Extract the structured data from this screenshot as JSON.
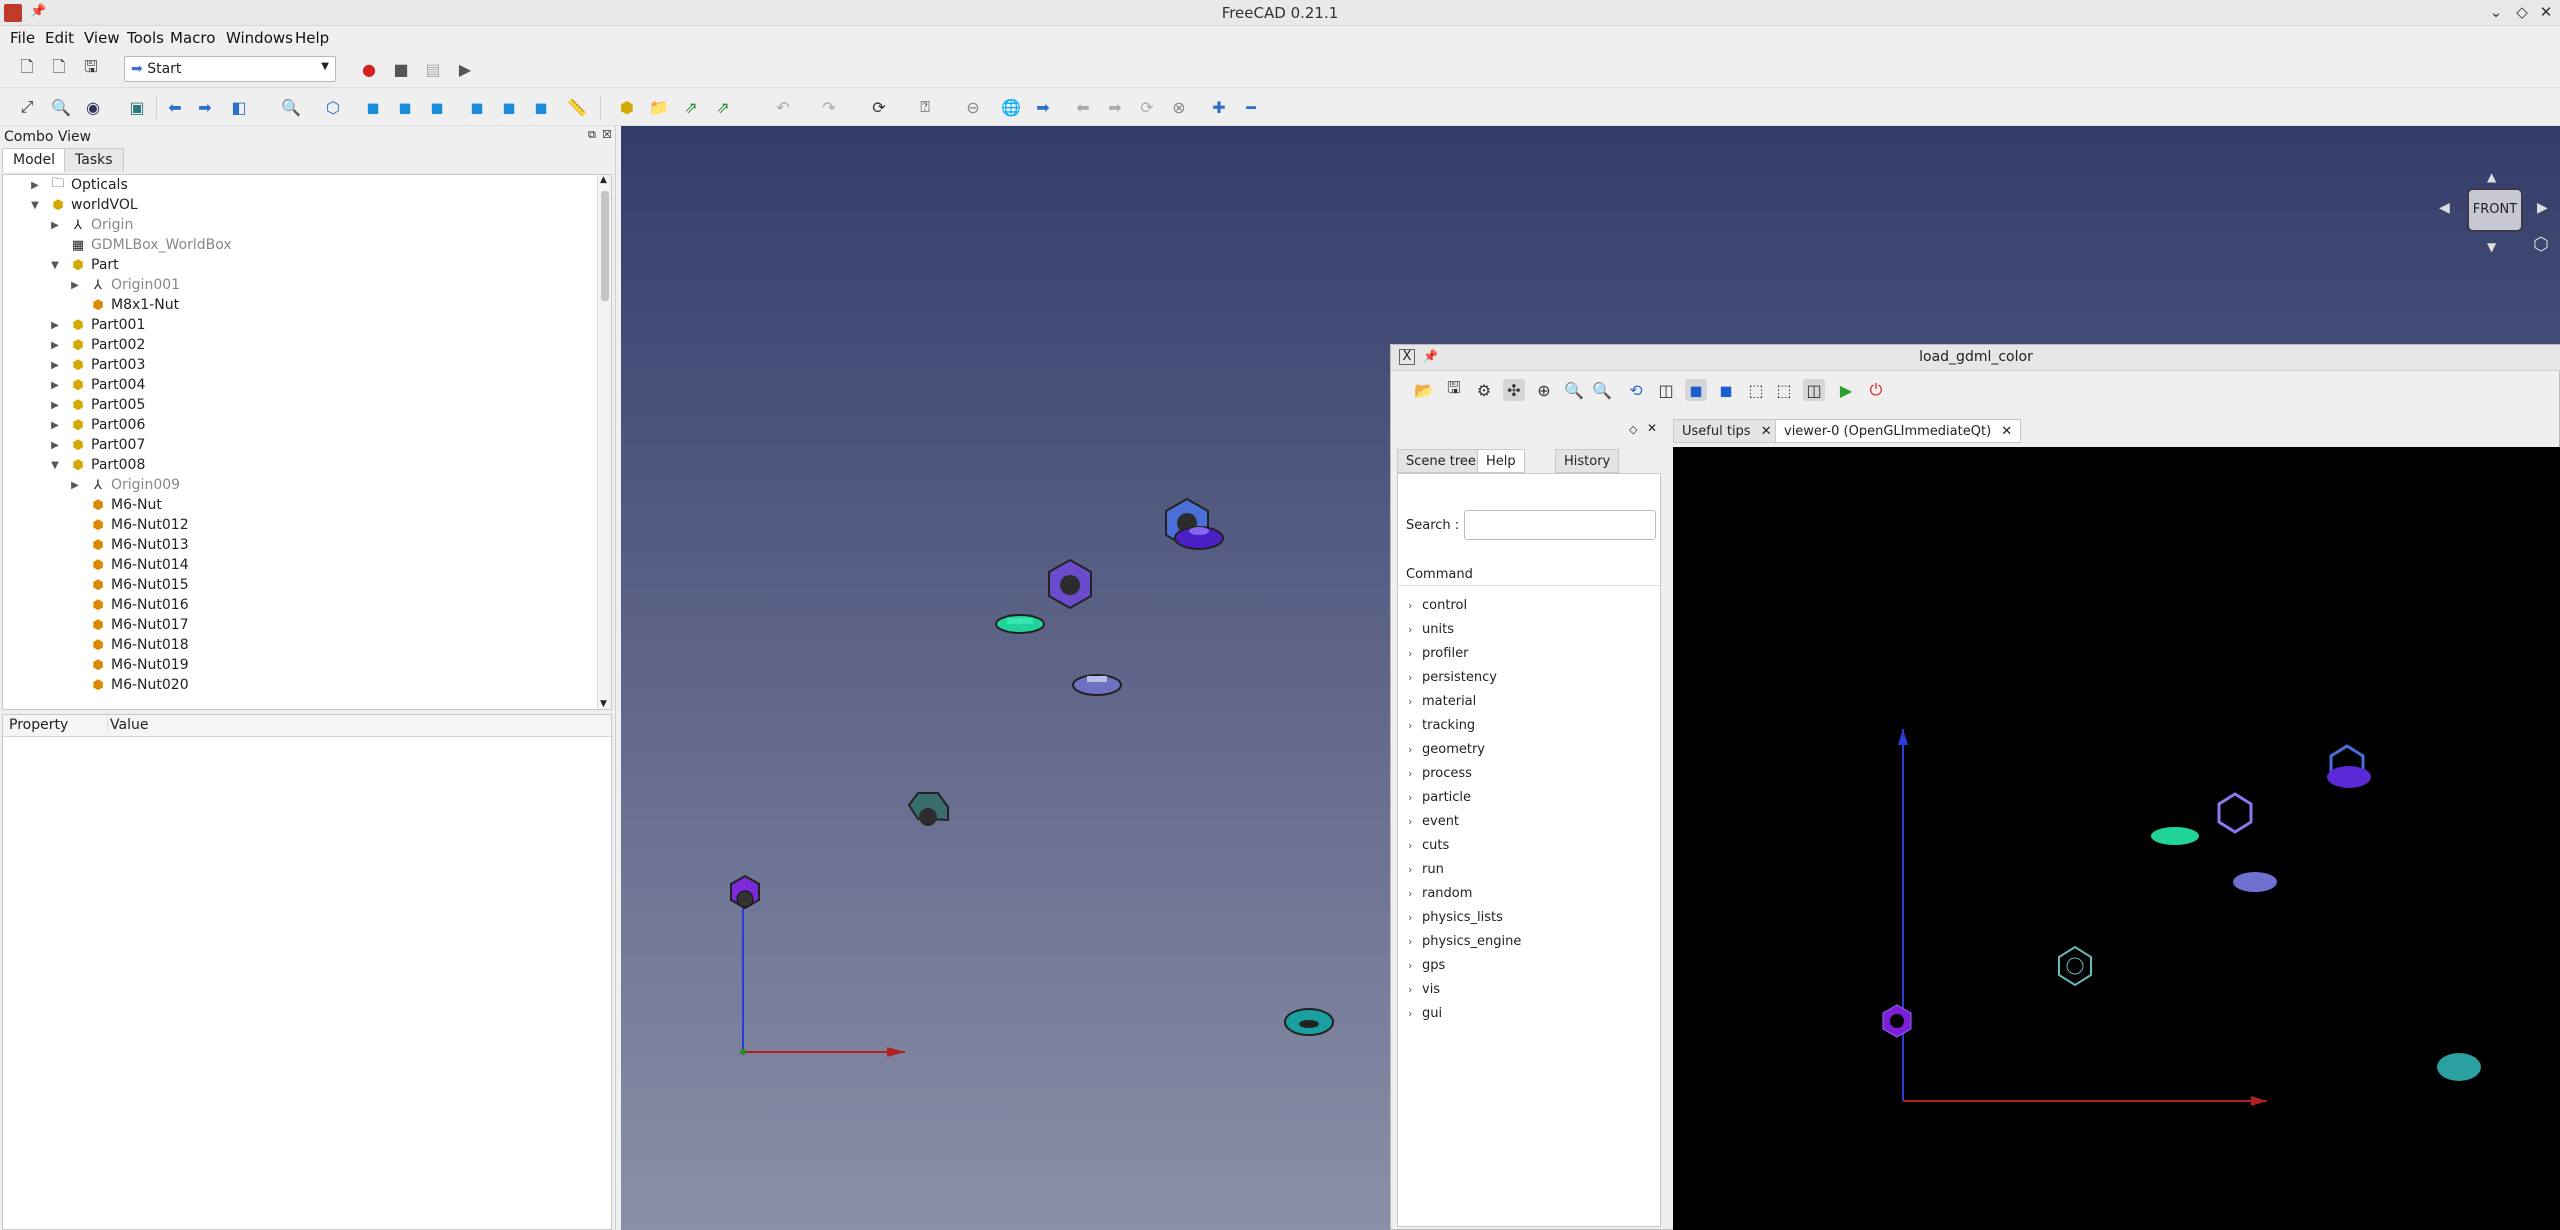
{
  "app": {
    "title": "FreeCAD 0.21.1"
  },
  "menu": [
    "File",
    "Edit",
    "View",
    "Tools",
    "Macro",
    "Windows",
    "Help"
  ],
  "toolbar": {
    "workbench": "Start"
  },
  "combo": {
    "title": "Combo View",
    "tabs": [
      "Model",
      "Tasks"
    ],
    "tree": [
      {
        "label": "Opticals",
        "indent": 0,
        "arrow": "right",
        "icon": "folder",
        "dim": false
      },
      {
        "label": "worldVOL",
        "indent": 0,
        "arrow": "down",
        "icon": "part",
        "dim": false
      },
      {
        "label": "Origin",
        "indent": 1,
        "arrow": "right",
        "icon": "axes",
        "dim": true
      },
      {
        "label": "GDMLBox_WorldBox",
        "indent": 1,
        "arrow": "",
        "icon": "box",
        "dim": true
      },
      {
        "label": "Part",
        "indent": 1,
        "arrow": "down",
        "icon": "part",
        "dim": false
      },
      {
        "label": "Origin001",
        "indent": 2,
        "arrow": "right",
        "icon": "axes",
        "dim": true
      },
      {
        "label": "M8x1-Nut",
        "indent": 2,
        "arrow": "",
        "icon": "nut",
        "dim": false
      },
      {
        "label": "Part001",
        "indent": 1,
        "arrow": "right",
        "icon": "part",
        "dim": false
      },
      {
        "label": "Part002",
        "indent": 1,
        "arrow": "right",
        "icon": "part",
        "dim": false
      },
      {
        "label": "Part003",
        "indent": 1,
        "arrow": "right",
        "icon": "part",
        "dim": false
      },
      {
        "label": "Part004",
        "indent": 1,
        "arrow": "right",
        "icon": "part",
        "dim": false
      },
      {
        "label": "Part005",
        "indent": 1,
        "arrow": "right",
        "icon": "part",
        "dim": false
      },
      {
        "label": "Part006",
        "indent": 1,
        "arrow": "right",
        "icon": "part",
        "dim": false
      },
      {
        "label": "Part007",
        "indent": 1,
        "arrow": "right",
        "icon": "part",
        "dim": false
      },
      {
        "label": "Part008",
        "indent": 1,
        "arrow": "down",
        "icon": "part",
        "dim": false
      },
      {
        "label": "Origin009",
        "indent": 2,
        "arrow": "right",
        "icon": "axes",
        "dim": true
      },
      {
        "label": "M6-Nut",
        "indent": 2,
        "arrow": "",
        "icon": "nut",
        "dim": false
      },
      {
        "label": "M6-Nut012",
        "indent": 2,
        "arrow": "",
        "icon": "nut",
        "dim": false
      },
      {
        "label": "M6-Nut013",
        "indent": 2,
        "arrow": "",
        "icon": "nut",
        "dim": false
      },
      {
        "label": "M6-Nut014",
        "indent": 2,
        "arrow": "",
        "icon": "nut",
        "dim": false
      },
      {
        "label": "M6-Nut015",
        "indent": 2,
        "arrow": "",
        "icon": "nut",
        "dim": false
      },
      {
        "label": "M6-Nut016",
        "indent": 2,
        "arrow": "",
        "icon": "nut",
        "dim": false
      },
      {
        "label": "M6-Nut017",
        "indent": 2,
        "arrow": "",
        "icon": "nut",
        "dim": false
      },
      {
        "label": "M6-Nut018",
        "indent": 2,
        "arrow": "",
        "icon": "nut",
        "dim": false
      },
      {
        "label": "M6-Nut019",
        "indent": 2,
        "arrow": "",
        "icon": "nut",
        "dim": false
      },
      {
        "label": "M6-Nut020",
        "indent": 2,
        "arrow": "",
        "icon": "nut",
        "dim": false
      }
    ],
    "props_headers": [
      "Property",
      "Value"
    ]
  },
  "navcube": {
    "face": "FRONT"
  },
  "g4": {
    "title": "load_gdml_color",
    "left_tabs": [
      "Scene tree",
      "Help",
      "History"
    ],
    "right_tabs": [
      "Useful tips",
      "viewer-0 (OpenGLImmediateQt)"
    ],
    "search_label": "Search :",
    "command_header": "Command",
    "commands": [
      "control",
      "units",
      "profiler",
      "persistency",
      "material",
      "tracking",
      "geometry",
      "process",
      "particle",
      "event",
      "cuts",
      "run",
      "random",
      "physics_lists",
      "physics_engine",
      "gps",
      "vis",
      "gui"
    ]
  },
  "colors": {
    "accent": "#3c6fd6",
    "viewTop": "#333d6a",
    "viewBottom": "#8b8fa8"
  }
}
